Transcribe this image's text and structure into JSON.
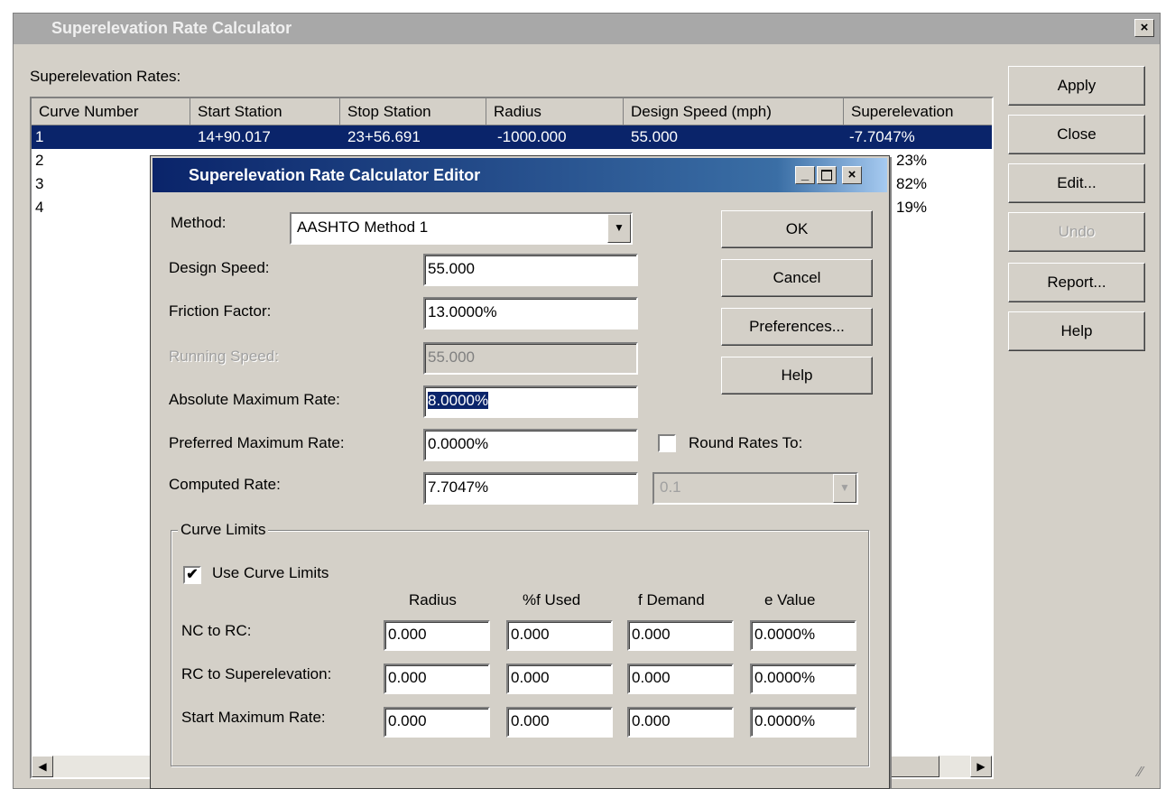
{
  "main_window": {
    "title": "Superelevation Rate Calculator",
    "close_glyph": "×",
    "rates_label": "Superelevation Rates:",
    "columns": [
      "Curve Number",
      "Start Station",
      "Stop Station",
      "Radius",
      "Design Speed (mph)",
      "Superelevation"
    ],
    "rows": [
      {
        "curve": "1",
        "start": "14+90.017",
        "stop": "23+56.691",
        "radius": "-1000.000",
        "speed": "55.000",
        "superelevation": "-7.7047%"
      },
      {
        "curve": "2",
        "superelevation": "23%"
      },
      {
        "curve": "3",
        "superelevation": "82%"
      },
      {
        "curve": "4",
        "superelevation": "19%"
      }
    ],
    "buttons": {
      "apply": "Apply",
      "close": "Close",
      "edit": "Edit...",
      "undo": "Undo",
      "report": "Report...",
      "help": "Help"
    }
  },
  "editor": {
    "title": "Superelevation Rate Calculator Editor",
    "method_label": "Method:",
    "method_value": "AASHTO Method 1",
    "design_speed_label": "Design Speed:",
    "design_speed_value": "55.000",
    "friction_factor_label": "Friction Factor:",
    "friction_factor_value": "13.0000%",
    "running_speed_label": "Running Speed:",
    "running_speed_value": "55.000",
    "abs_max_rate_label": "Absolute Maximum Rate:",
    "abs_max_rate_value": "8.0000%",
    "pref_max_rate_label": "Preferred Maximum Rate:",
    "pref_max_rate_value": "0.0000%",
    "computed_rate_label": "Computed Rate:",
    "computed_rate_value": "7.7047%",
    "round_rates_label": "Round Rates To:",
    "round_rates_checked": false,
    "round_rates_value": "0.1",
    "buttons": {
      "ok": "OK",
      "cancel": "Cancel",
      "preferences": "Preferences...",
      "help": "Help"
    },
    "curve_limits": {
      "group_label": "Curve Limits",
      "use_curve_limits_label": "Use Curve Limits",
      "use_curve_limits_checked": true,
      "columns": [
        "Radius",
        "%f Used",
        "f Demand",
        "e Value"
      ],
      "rows": [
        {
          "label": "NC to RC:",
          "values": [
            "0.000",
            "0.000",
            "0.000",
            "0.0000%"
          ]
        },
        {
          "label": "RC to Superelevation:",
          "values": [
            "0.000",
            "0.000",
            "0.000",
            "0.0000%"
          ]
        },
        {
          "label": "Start Maximum Rate:",
          "values": [
            "0.000",
            "0.000",
            "0.000",
            "0.0000%"
          ]
        }
      ]
    }
  },
  "glyphs": {
    "dropdown_arrow": "▼",
    "scroll_left": "◀",
    "scroll_right": "▶",
    "check_mark": "✔",
    "minimize": "_",
    "close": "×",
    "resize_grip": "⁄⁄"
  }
}
